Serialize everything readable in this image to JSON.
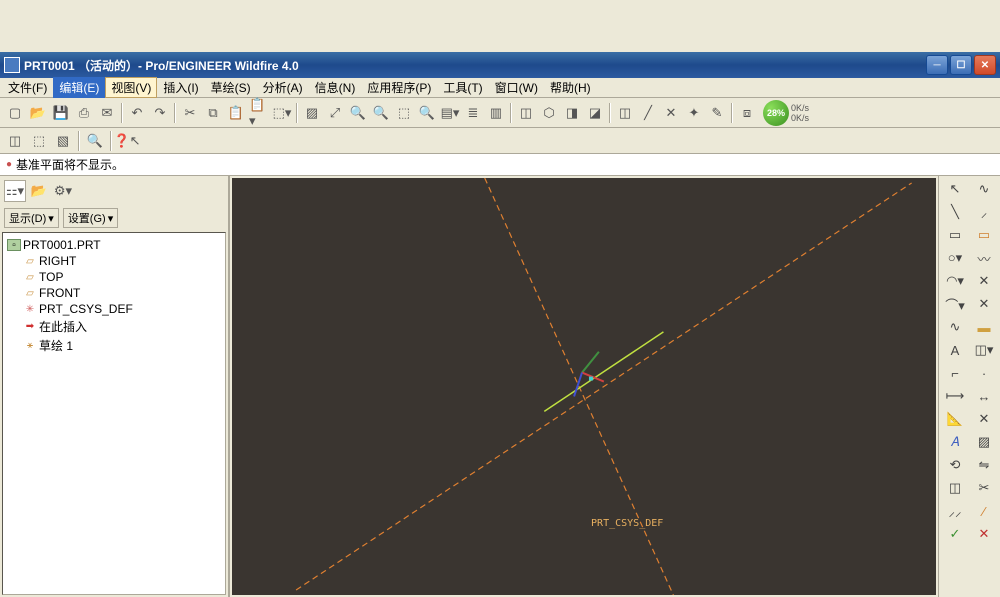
{
  "window": {
    "title": "PRT0001 （活动的）- Pro/ENGINEER Wildfire 4.0"
  },
  "menu": {
    "file": "文件(F)",
    "edit": "编辑(E)",
    "view": "视图(V)",
    "insert": "插入(I)",
    "sketch": "草绘(S)",
    "analysis": "分析(A)",
    "info": "信息(N)",
    "applications": "应用程序(P)",
    "tools": "工具(T)",
    "window": "窗口(W)",
    "help": "帮助(H)"
  },
  "message": "基准平面将不显示。",
  "left_panel": {
    "display_btn": "显示(D)",
    "settings_btn": "设置(G)",
    "tree": {
      "root": "PRT0001.PRT",
      "items": [
        {
          "icon": "plane",
          "label": "RIGHT"
        },
        {
          "icon": "plane",
          "label": "TOP"
        },
        {
          "icon": "plane",
          "label": "FRONT"
        },
        {
          "icon": "csys",
          "label": "PRT_CSYS_DEF"
        },
        {
          "icon": "insert",
          "label": "在此插入"
        },
        {
          "icon": "sketch",
          "label": "草绘 1"
        }
      ]
    }
  },
  "viewport": {
    "csys_label": "PRT_CSYS_DEF"
  },
  "perf": {
    "percent": "28%",
    "top": "0K/s",
    "bottom": "0K/s"
  }
}
